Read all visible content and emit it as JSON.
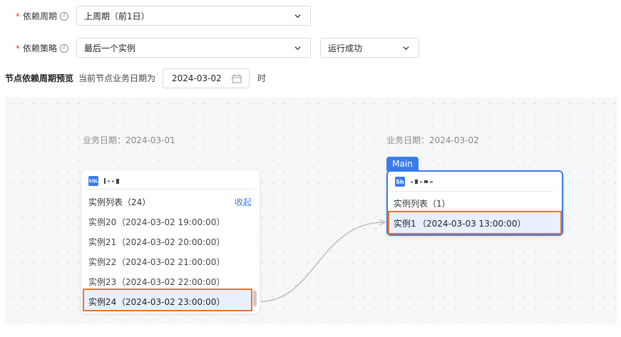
{
  "form": {
    "period": {
      "required_mark": "*",
      "label": "依赖周期",
      "value": "上周期（前1日）"
    },
    "strategy": {
      "required_mark": "*",
      "label": "依赖策略",
      "value": "最后一个实例",
      "status_value": "运行成功"
    }
  },
  "preview": {
    "title": "节点依赖周期预览",
    "subtitle": "当前节点业务日期为",
    "date": "2024-03-02",
    "suffix": "时"
  },
  "left_node": {
    "biz_date_label": "业务日期：2024-03-01",
    "type_badge": "SQL",
    "list_title": "实例列表（24）",
    "collapse_label": "收起",
    "instances": [
      {
        "name": "实例20",
        "time": "（2024-03-02 19:00:00）"
      },
      {
        "name": "实例21",
        "time": "（2024-03-02 20:00:00）"
      },
      {
        "name": "实例22",
        "time": "（2024-03-02 21:00:00）"
      },
      {
        "name": "实例23",
        "time": "（2024-03-02 22:00:00）"
      },
      {
        "name": "实例24",
        "time": "（2024-03-02 23:00:00）"
      }
    ]
  },
  "right_node": {
    "biz_date_label": "业务日期：2024-03-02",
    "tab_label": "Main",
    "type_badge": "Sh",
    "list_title": "实例列表（1）",
    "instances": [
      {
        "name": "实例1",
        "time": "（2024-03-03 13:00:00）"
      }
    ]
  },
  "colors": {
    "accent": "#3b7ced",
    "highlight_border": "#e8732a",
    "selected_bg": "#e8f0fd"
  },
  "icons": [
    "info-icon",
    "chevron-down-icon",
    "calendar-icon",
    "sql-icon",
    "shell-icon"
  ]
}
